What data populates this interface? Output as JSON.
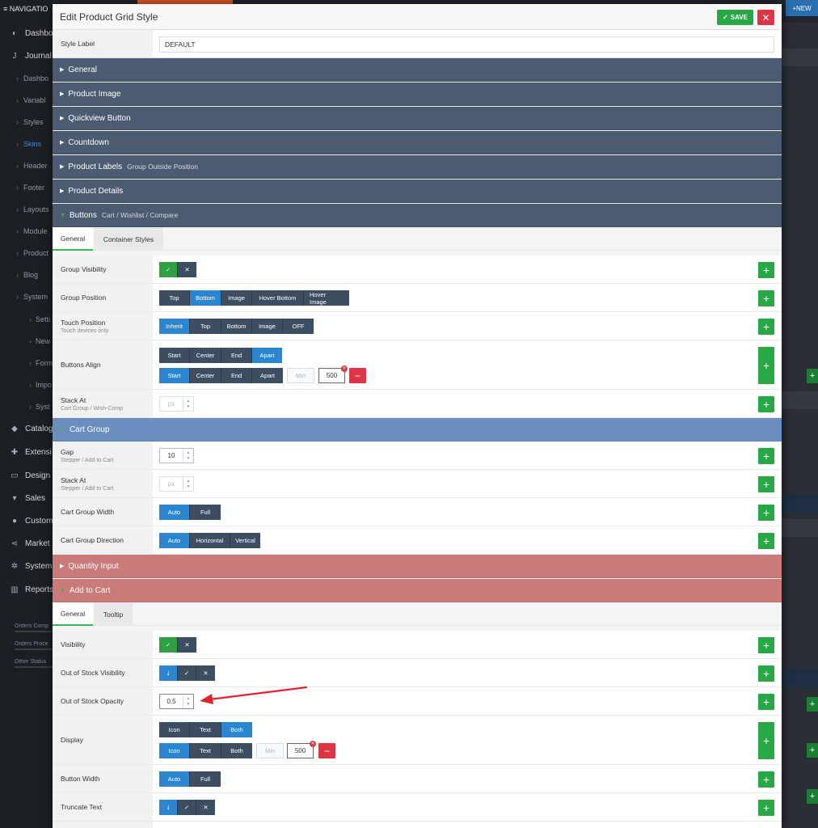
{
  "background": {
    "nav_title": "NAVIGATIO",
    "new_button": "NEW",
    "sidebar": [
      {
        "label": "Dashbo",
        "icon": "speedometer-icon",
        "glyph": "◐",
        "kind": "main"
      },
      {
        "label": "Journal",
        "icon": "journal-j-icon",
        "glyph": "J",
        "kind": "main"
      },
      {
        "label": "Dashbo",
        "kind": "sub"
      },
      {
        "label": "Variabl",
        "kind": "sub"
      },
      {
        "label": "Styles",
        "kind": "sub"
      },
      {
        "label": "Skins",
        "kind": "sub",
        "active": true
      },
      {
        "label": "Header",
        "kind": "sub"
      },
      {
        "label": "Footer",
        "kind": "sub"
      },
      {
        "label": "Layouts",
        "kind": "sub"
      },
      {
        "label": "Module",
        "kind": "sub"
      },
      {
        "label": "Product",
        "kind": "sub"
      },
      {
        "label": "Blog",
        "kind": "sub"
      },
      {
        "label": "System",
        "kind": "sub"
      },
      {
        "label": "Setti",
        "kind": "sub2"
      },
      {
        "label": "New",
        "kind": "sub2"
      },
      {
        "label": "Form",
        "kind": "sub2"
      },
      {
        "label": "Impo",
        "kind": "sub2"
      },
      {
        "label": "Syst",
        "kind": "sub2"
      },
      {
        "label": "Catalog",
        "icon": "tag-icon",
        "glyph": "◆",
        "kind": "main"
      },
      {
        "label": "Extensi",
        "icon": "puzzle-icon",
        "glyph": "✚",
        "kind": "main"
      },
      {
        "label": "Design",
        "icon": "monitor-icon",
        "glyph": "▭",
        "kind": "main"
      },
      {
        "label": "Sales",
        "icon": "cart-icon",
        "glyph": "▾",
        "kind": "main"
      },
      {
        "label": "Custom",
        "icon": "user-icon",
        "glyph": "●",
        "kind": "main"
      },
      {
        "label": "Market",
        "icon": "share-icon",
        "glyph": "⋖",
        "kind": "main"
      },
      {
        "label": "System",
        "icon": "gear-icon",
        "glyph": "✲",
        "kind": "main"
      },
      {
        "label": "Reports",
        "icon": "bar-chart-icon",
        "glyph": "▥",
        "kind": "main"
      }
    ],
    "stats": [
      "Orders Comp",
      "Orders Proce",
      "Other Status"
    ]
  },
  "modal": {
    "title": "Edit Product Grid Style",
    "save_label": "SAVE",
    "close_glyph": "✕",
    "style_label": {
      "label": "Style Label",
      "value": "DEFAULT"
    },
    "sections": {
      "general": {
        "label": "General"
      },
      "product_image": {
        "label": "Product Image"
      },
      "quickview": {
        "label": "Quickview Button"
      },
      "countdown": {
        "label": "Countdown"
      },
      "product_labels": {
        "label": "Product Labels",
        "sub": "Group Outside Position"
      },
      "product_details": {
        "label": "Product Details"
      },
      "buttons": {
        "label": "Buttons",
        "sub": "Cart / Wishlist / Compare"
      },
      "cart_group": {
        "label": "Cart Group"
      },
      "quantity_input": {
        "label": "Quantity Input"
      },
      "add_to_cart": {
        "label": "Add to Cart"
      }
    },
    "buttons_tabs": [
      "General",
      "Container Styles"
    ],
    "add_to_cart_tabs": [
      "General",
      "Tooltip"
    ],
    "rows": {
      "group_visibility": {
        "label": "Group Visibility"
      },
      "group_position": {
        "label": "Group Position",
        "options": [
          "Top",
          "Bottom",
          "Image",
          "Hover Bottom",
          "Hover Image"
        ],
        "selected": "Bottom"
      },
      "touch_position": {
        "label": "Touch Position",
        "sub": "Touch devices only",
        "options": [
          "Inherit",
          "Top",
          "Bottom",
          "Image",
          "OFF"
        ],
        "selected": "Inherit"
      },
      "buttons_align": {
        "label": "Buttons Align",
        "options": [
          "Start",
          "Center",
          "End",
          "Apart"
        ],
        "selected_1": "Apart",
        "selected_2": "Start",
        "min_placeholder": "Min",
        "value": "500"
      },
      "stack_at": {
        "label": "Stack At",
        "sub": "Cart Group / Wish-Comp",
        "placeholder": "px"
      },
      "gap": {
        "label": "Gap",
        "sub": "Stepper / Add to Cart",
        "value": "10"
      },
      "cart_stack_at": {
        "label": "Stack At",
        "sub": "Stepper / Add to Cart",
        "placeholder": "px"
      },
      "cart_group_width": {
        "label": "Cart Group Width",
        "options": [
          "Auto",
          "Full"
        ],
        "selected": "Auto"
      },
      "cart_group_direction": {
        "label": "Cart Group Direction",
        "options": [
          "Auto",
          "Horizontal",
          "Vertical"
        ],
        "selected": "Auto"
      },
      "visibility": {
        "label": "Visibility"
      },
      "out_of_stock_visibility": {
        "label": "Out of Stock Visibility"
      },
      "out_of_stock_opacity": {
        "label": "Out of Stock Opacity",
        "value": "0.5"
      },
      "display": {
        "label": "Display",
        "options": [
          "Icon",
          "Text",
          "Both"
        ],
        "selected_1": "Both",
        "selected_2": "Icon",
        "min_placeholder": "Min",
        "value": "500"
      },
      "button_width": {
        "label": "Button Width",
        "options": [
          "Auto",
          "Full"
        ],
        "selected": "Auto"
      },
      "truncate_text": {
        "label": "Truncate Text"
      }
    },
    "glyphs": {
      "check": "✓",
      "cross": "✕",
      "down_arrow": "⭣",
      "plus": "+",
      "minus": "−",
      "caret_right": "▶",
      "caret_down": "▼"
    },
    "annotation": {
      "color": "#e0242b"
    }
  }
}
